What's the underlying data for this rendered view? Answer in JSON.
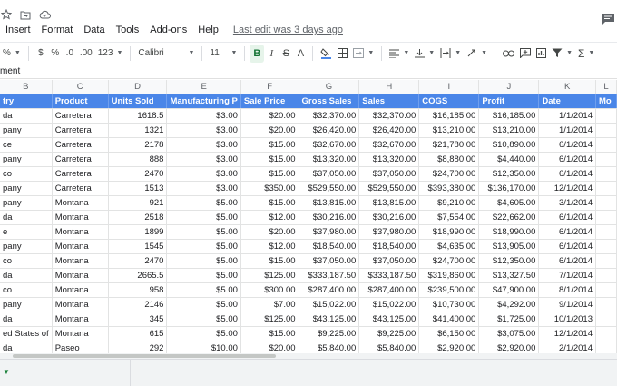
{
  "title_icons": [
    "star-icon",
    "move-to-folder-icon",
    "cloud-status-icon"
  ],
  "menu": {
    "items": [
      "Insert",
      "Format",
      "Data",
      "Tools",
      "Add-ons",
      "Help"
    ],
    "last_edit": "Last edit was 3 days ago"
  },
  "toolbar": {
    "zoom_partial": "%",
    "currency": "$",
    "percent": "%",
    "dec_decrease": ".0",
    "dec_increase": ".00",
    "more_formats": "123",
    "font": "Calibri",
    "font_size": "11",
    "bold": "B",
    "italic": "I",
    "strike": "S",
    "text_color": "A"
  },
  "formula_bar": {
    "value": "ment"
  },
  "columns": [
    "B",
    "C",
    "D",
    "E",
    "F",
    "G",
    "H",
    "I",
    "J",
    "K",
    "L"
  ],
  "header_row": [
    "try",
    "Product",
    "Units Sold",
    "Manufacturing P",
    "Sale Price",
    "Gross Sales",
    "Sales",
    "COGS",
    "Profit",
    "Date",
    "Mo"
  ],
  "rows": [
    [
      "da",
      "Carretera",
      "1618.5",
      "$3.00",
      "$20.00",
      "$32,370.00",
      "$32,370.00",
      "$16,185.00",
      "$16,185.00",
      "1/1/2014",
      ""
    ],
    [
      "pany",
      "Carretera",
      "1321",
      "$3.00",
      "$20.00",
      "$26,420.00",
      "$26,420.00",
      "$13,210.00",
      "$13,210.00",
      "1/1/2014",
      ""
    ],
    [
      "ce",
      "Carretera",
      "2178",
      "$3.00",
      "$15.00",
      "$32,670.00",
      "$32,670.00",
      "$21,780.00",
      "$10,890.00",
      "6/1/2014",
      ""
    ],
    [
      "pany",
      "Carretera",
      "888",
      "$3.00",
      "$15.00",
      "$13,320.00",
      "$13,320.00",
      "$8,880.00",
      "$4,440.00",
      "6/1/2014",
      ""
    ],
    [
      "co",
      "Carretera",
      "2470",
      "$3.00",
      "$15.00",
      "$37,050.00",
      "$37,050.00",
      "$24,700.00",
      "$12,350.00",
      "6/1/2014",
      ""
    ],
    [
      "pany",
      "Carretera",
      "1513",
      "$3.00",
      "$350.00",
      "$529,550.00",
      "$529,550.00",
      "$393,380.00",
      "$136,170.00",
      "12/1/2014",
      ""
    ],
    [
      "pany",
      "Montana",
      "921",
      "$5.00",
      "$15.00",
      "$13,815.00",
      "$13,815.00",
      "$9,210.00",
      "$4,605.00",
      "3/1/2014",
      ""
    ],
    [
      "da",
      "Montana",
      "2518",
      "$5.00",
      "$12.00",
      "$30,216.00",
      "$30,216.00",
      "$7,554.00",
      "$22,662.00",
      "6/1/2014",
      ""
    ],
    [
      "e",
      "Montana",
      "1899",
      "$5.00",
      "$20.00",
      "$37,980.00",
      "$37,980.00",
      "$18,990.00",
      "$18,990.00",
      "6/1/2014",
      ""
    ],
    [
      "pany",
      "Montana",
      "1545",
      "$5.00",
      "$12.00",
      "$18,540.00",
      "$18,540.00",
      "$4,635.00",
      "$13,905.00",
      "6/1/2014",
      ""
    ],
    [
      "co",
      "Montana",
      "2470",
      "$5.00",
      "$15.00",
      "$37,050.00",
      "$37,050.00",
      "$24,700.00",
      "$12,350.00",
      "6/1/2014",
      ""
    ],
    [
      "da",
      "Montana",
      "2665.5",
      "$5.00",
      "$125.00",
      "$333,187.50",
      "$333,187.50",
      "$319,860.00",
      "$13,327.50",
      "7/1/2014",
      ""
    ],
    [
      "co",
      "Montana",
      "958",
      "$5.00",
      "$300.00",
      "$287,400.00",
      "$287,400.00",
      "$239,500.00",
      "$47,900.00",
      "8/1/2014",
      ""
    ],
    [
      "pany",
      "Montana",
      "2146",
      "$5.00",
      "$7.00",
      "$15,022.00",
      "$15,022.00",
      "$10,730.00",
      "$4,292.00",
      "9/1/2014",
      ""
    ],
    [
      "da",
      "Montana",
      "345",
      "$5.00",
      "$125.00",
      "$43,125.00",
      "$43,125.00",
      "$41,400.00",
      "$1,725.00",
      "10/1/2013",
      ""
    ],
    [
      "ed States of",
      "Montana",
      "615",
      "$5.00",
      "$15.00",
      "$9,225.00",
      "$9,225.00",
      "$6,150.00",
      "$3,075.00",
      "12/1/2014",
      ""
    ],
    [
      "da",
      "Paseo",
      "292",
      "$10.00",
      "$20.00",
      "$5,840.00",
      "$5,840.00",
      "$2,920.00",
      "$2,920.00",
      "2/1/2014",
      ""
    ]
  ]
}
